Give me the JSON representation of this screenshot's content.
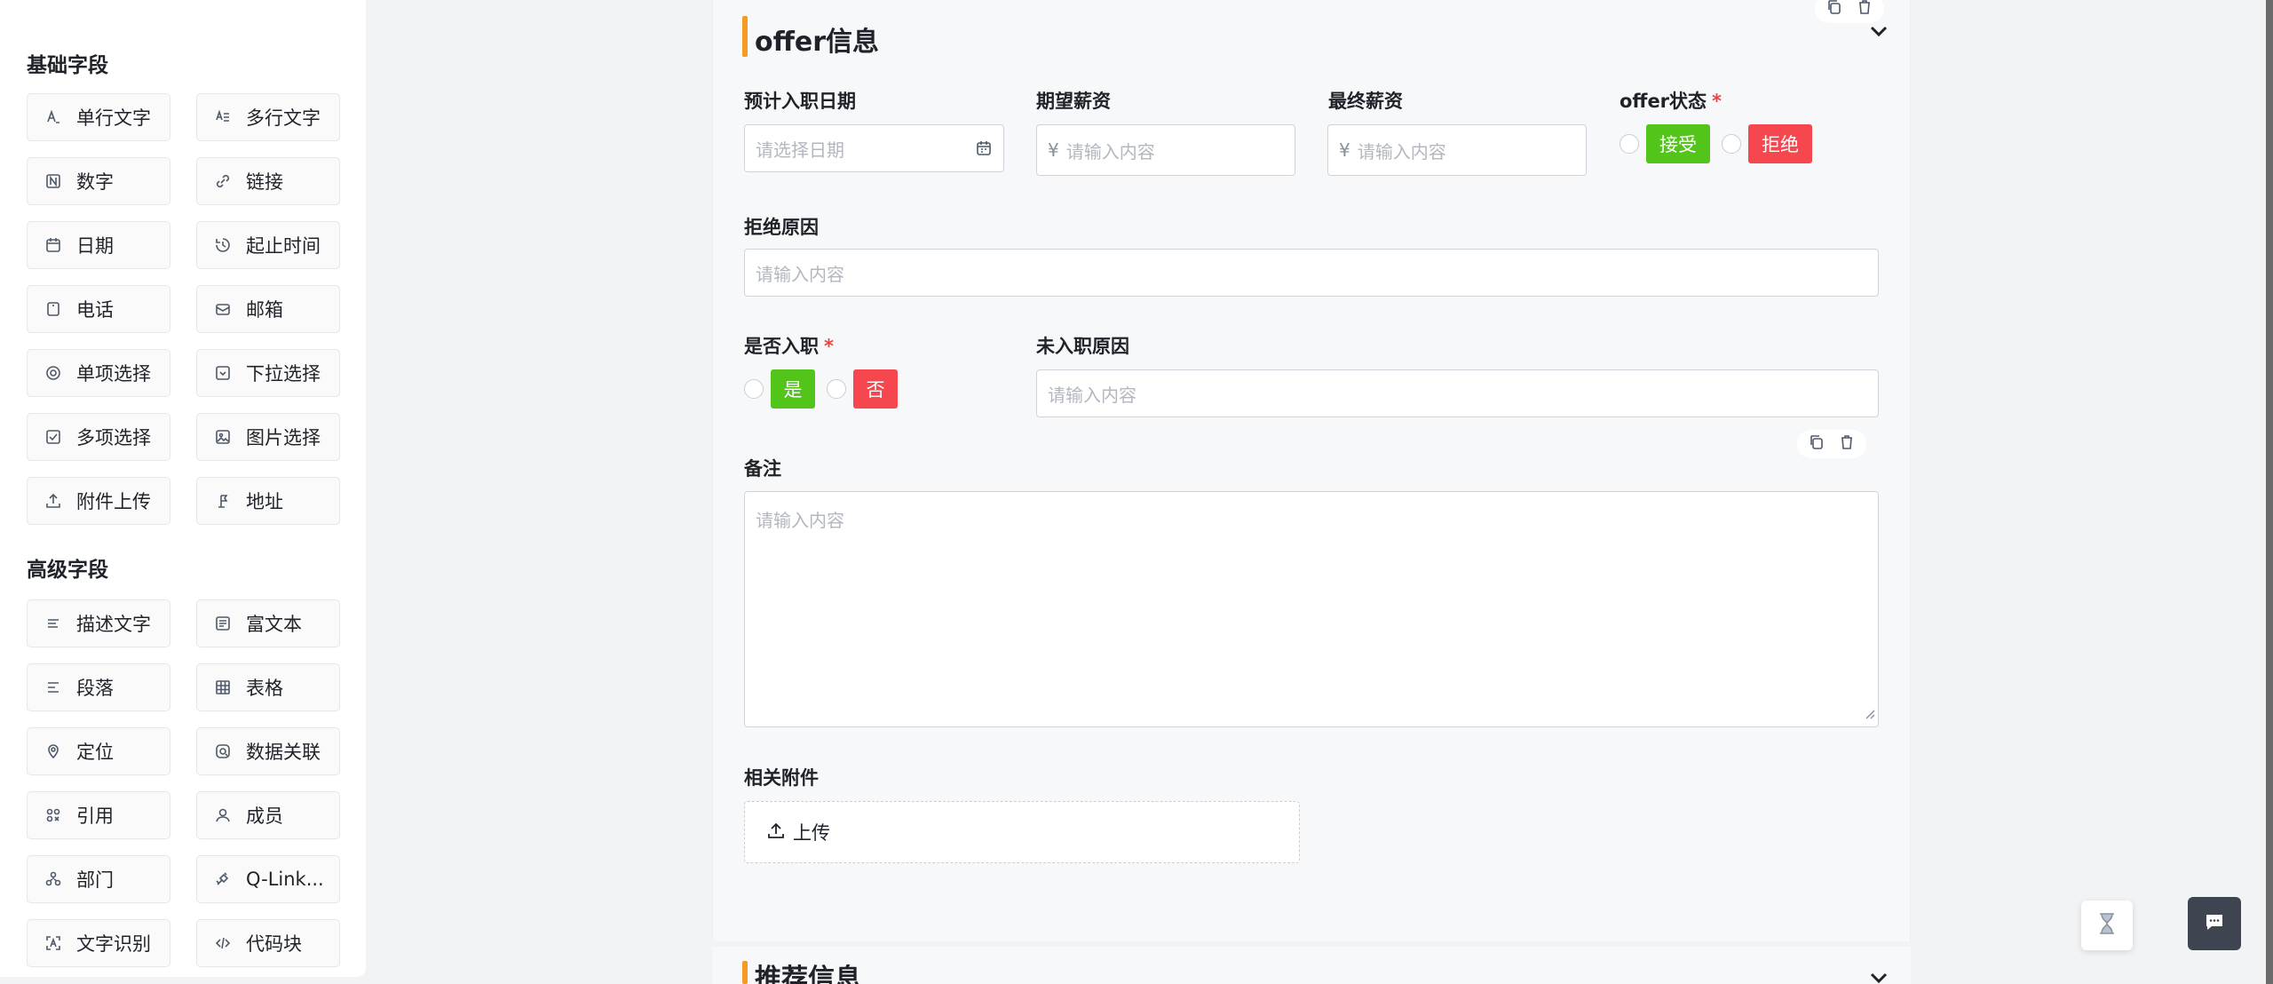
{
  "palette": {
    "basic_title": "基础字段",
    "basic": [
      {
        "label": "单行文字",
        "icon": "single-line-text-icon"
      },
      {
        "label": "多行文字",
        "icon": "multi-line-text-icon"
      },
      {
        "label": "数字",
        "icon": "number-icon"
      },
      {
        "label": "链接",
        "icon": "link-icon"
      },
      {
        "label": "日期",
        "icon": "calendar-icon"
      },
      {
        "label": "起止时间",
        "icon": "time-range-icon"
      },
      {
        "label": "电话",
        "icon": "phone-icon"
      },
      {
        "label": "邮箱",
        "icon": "mail-icon"
      },
      {
        "label": "单项选择",
        "icon": "radio-icon"
      },
      {
        "label": "下拉选择",
        "icon": "dropdown-icon"
      },
      {
        "label": "多项选择",
        "icon": "checkbox-icon"
      },
      {
        "label": "图片选择",
        "icon": "image-icon"
      },
      {
        "label": "附件上传",
        "icon": "upload-icon"
      },
      {
        "label": "地址",
        "icon": "address-icon"
      }
    ],
    "advanced_title": "高级字段",
    "advanced": [
      {
        "label": "描述文字",
        "icon": "description-icon"
      },
      {
        "label": "富文本",
        "icon": "rich-text-icon"
      },
      {
        "label": "段落",
        "icon": "paragraph-icon"
      },
      {
        "label": "表格",
        "icon": "table-icon"
      },
      {
        "label": "定位",
        "icon": "location-icon"
      },
      {
        "label": "数据关联",
        "icon": "data-link-icon"
      },
      {
        "label": "引用",
        "icon": "reference-icon"
      },
      {
        "label": "成员",
        "icon": "member-icon"
      },
      {
        "label": "部门",
        "icon": "department-icon"
      },
      {
        "label": "Q-Link...",
        "icon": "q-link-icon"
      },
      {
        "label": "文字识别",
        "icon": "ocr-icon"
      },
      {
        "label": "代码块",
        "icon": "code-icon"
      }
    ]
  },
  "form": {
    "section_title": "offer信息",
    "entry_date_label": "预计入职日期",
    "entry_date_placeholder": "请选择日期",
    "expected_salary_label": "期望薪资",
    "final_salary_label": "最终薪资",
    "currency_prefix": "¥",
    "input_placeholder": "请输入内容",
    "offer_status_label": "offer状态",
    "required_mark": "*",
    "offer_accept": "接受",
    "offer_reject": "拒绝",
    "reject_reason_label": "拒绝原因",
    "joined_label": "是否入职",
    "joined_yes": "是",
    "joined_no": "否",
    "not_joined_reason_label": "未入职原因",
    "remark_label": "备注",
    "attachment_label": "相关附件",
    "upload_label": "上传",
    "next_section_title": "推荐信息"
  },
  "colors": {
    "accent": "#f59a23",
    "success": "#52c41a",
    "danger": "#f5474d"
  }
}
